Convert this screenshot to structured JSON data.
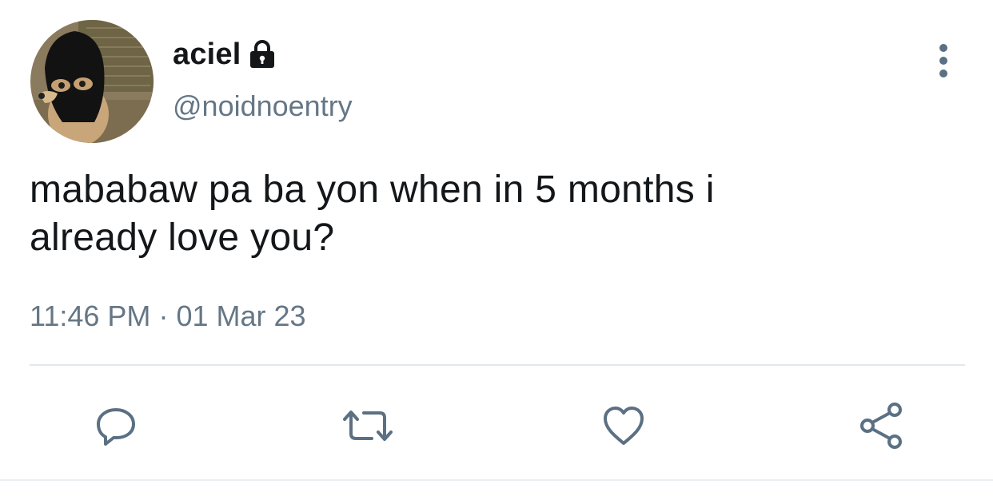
{
  "tweet": {
    "author": {
      "display_name": "aciel",
      "handle": "@noidnoentry",
      "protected_icon": "lock-icon",
      "avatar_icon": "avatar"
    },
    "text_lines": [
      "mababaw pa ba yon when in 5 months i",
      "already love you?"
    ],
    "time": "11:46 PM",
    "separator": "·",
    "date": "01 Mar 23",
    "more_icon": "more-vertical-icon"
  },
  "actions": [
    {
      "name": "reply",
      "icon": "reply-icon"
    },
    {
      "name": "retweet",
      "icon": "retweet-icon"
    },
    {
      "name": "like",
      "icon": "heart-icon"
    },
    {
      "name": "share",
      "icon": "share-icon"
    }
  ],
  "colors": {
    "text": "#14171a",
    "secondary": "#657786",
    "icon": "#5b7083",
    "divider": "#e1e8ed"
  }
}
